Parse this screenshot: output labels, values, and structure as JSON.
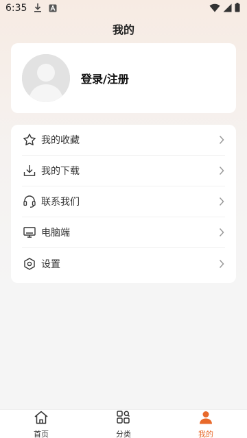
{
  "status": {
    "time": "6:35"
  },
  "header": {
    "title": "我的"
  },
  "profile": {
    "login_label": "登录/注册"
  },
  "menu": {
    "items": [
      {
        "label": "我的收藏",
        "icon": "star-icon"
      },
      {
        "label": "我的下载",
        "icon": "download-icon"
      },
      {
        "label": "联系我们",
        "icon": "headset-icon"
      },
      {
        "label": "电脑端",
        "icon": "monitor-icon"
      },
      {
        "label": "设置",
        "icon": "settings-hexagon-icon"
      }
    ]
  },
  "bottom_nav": {
    "items": [
      {
        "label": "首页",
        "icon": "home-icon",
        "active": false
      },
      {
        "label": "分类",
        "icon": "category-icon",
        "active": false
      },
      {
        "label": "我的",
        "icon": "person-icon",
        "active": true
      }
    ]
  },
  "colors": {
    "accent": "#e8692b",
    "avatar_bg": "#e2e2e2"
  }
}
